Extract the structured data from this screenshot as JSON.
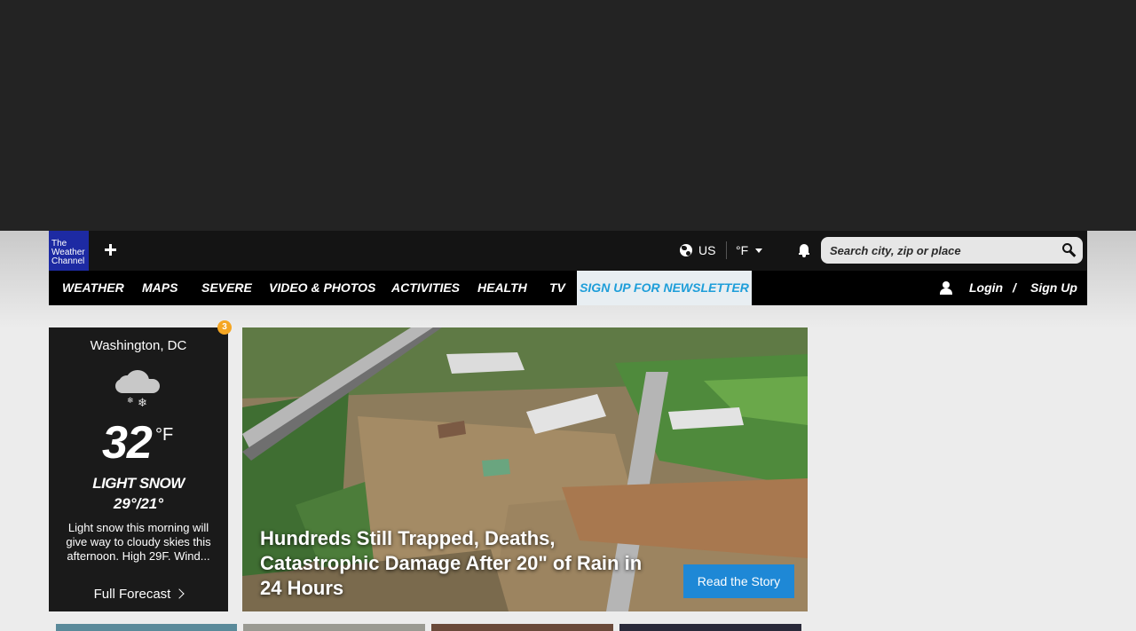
{
  "header": {
    "logo_text": "The Weather Channel",
    "region": "US",
    "unit": "°F",
    "search": {
      "placeholder": "Search city, zip or place"
    }
  },
  "nav": {
    "items": [
      "WEATHER",
      "MAPS",
      "SEVERE",
      "VIDEO & PHOTOS",
      "ACTIVITIES",
      "HEALTH",
      "TV"
    ],
    "newsletter": "SIGN UP FOR NEWSLETTER",
    "login": "Login",
    "separator": "/",
    "signup": "Sign Up"
  },
  "weather": {
    "alert_count": "3",
    "city": "Washington, DC",
    "icon": "cloud-snow-icon",
    "temperature": "32",
    "degree_unit": "°F",
    "phrase": "LIGHT SNOW",
    "hi_lo": "29°/21°",
    "narrative": "Light snow this morning will give way to cloudy skies this afternoon. High 29F. Wind...",
    "full_forecast": "Full Forecast"
  },
  "hero": {
    "headline": "Hundreds Still Trapped, Deaths, Catastrophic Damage After 20\" of Rain in 24 Hours",
    "cta": "Read the Story"
  },
  "colors": {
    "ad_background": "#232323",
    "logo_blue": "#1d2aa3",
    "newsletter_blue": "#1e9ed9",
    "cta_blue": "#1e88d6",
    "badge_orange": "#f5a623"
  }
}
